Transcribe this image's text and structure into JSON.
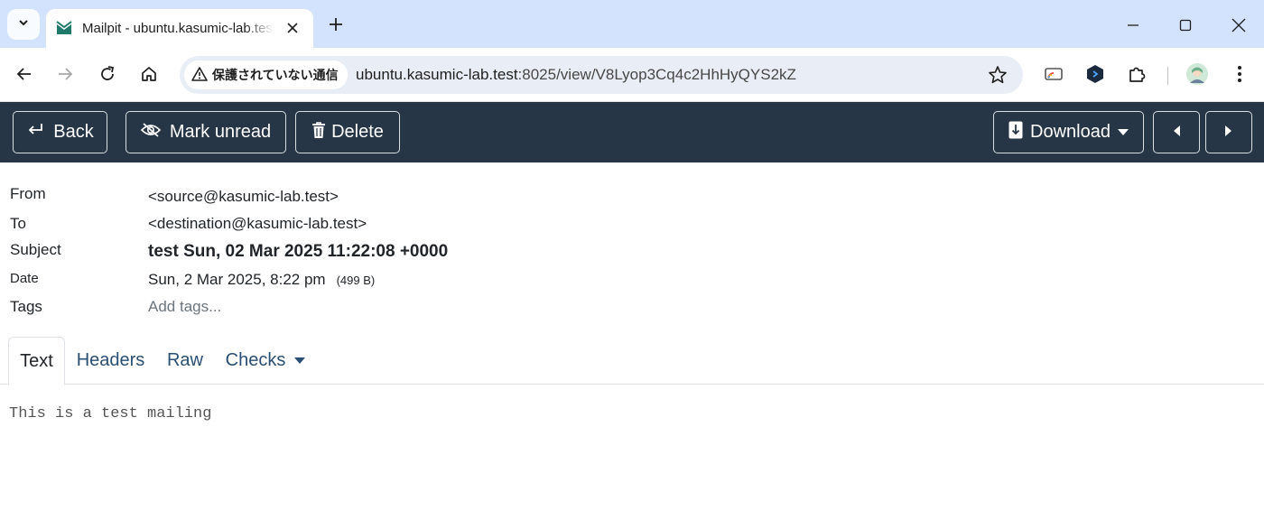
{
  "browser": {
    "tab_title": "Mailpit - ubuntu.kasumic-lab.test",
    "security_label": "保護されていない通信",
    "url_host": "ubuntu.kasumic-lab.test",
    "url_path": ":8025/view/V8Lyop3Cq4c2HhHyQYS2kZ"
  },
  "toolbar": {
    "back_label": "Back",
    "mark_unread_label": "Mark unread",
    "delete_label": "Delete",
    "download_label": "Download"
  },
  "message": {
    "from_label": "From",
    "from_value": "<source@kasumic-lab.test>",
    "to_label": "To",
    "to_value": "<destination@kasumic-lab.test>",
    "subject_label": "Subject",
    "subject_value": "test Sun, 02 Mar 2025 11:22:08 +0000",
    "date_label": "Date",
    "date_value": "Sun, 2 Mar 2025, 8:22 pm",
    "size_value": "(499 B)",
    "tags_label": "Tags",
    "tags_placeholder": "Add tags..."
  },
  "tabs": [
    "Text",
    "Headers",
    "Raw",
    "Checks"
  ],
  "active_tab": "Text",
  "body_text": "This is a test mailing",
  "colors": {
    "navbar": "#263646",
    "tabstrip": "#d3e3fd",
    "link": "#2a4f72"
  }
}
